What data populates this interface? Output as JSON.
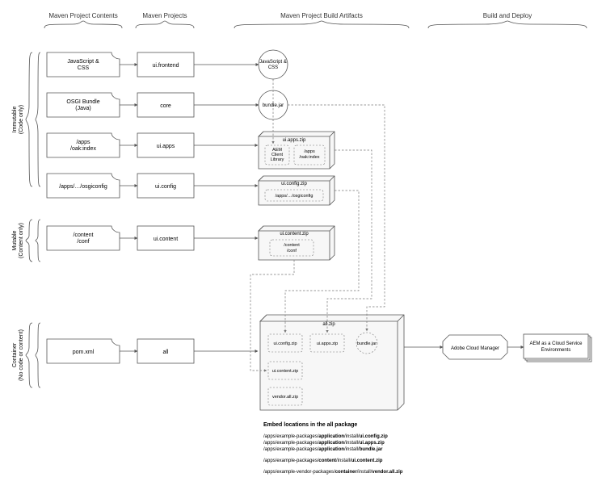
{
  "columns": {
    "contents": "Maven Project Contents",
    "projects": "Maven Projects",
    "artifacts": "Maven Project Build Artifacts",
    "deploy": "Build and Deploy"
  },
  "sideLabels": {
    "immutable1": "Immutable",
    "immutable2": "(Code only)",
    "mutable1": "Mutable",
    "mutable2": "(Content only)",
    "container1": "Container",
    "container2": "(No code or content)"
  },
  "contents": {
    "r0a": "JavaScript &",
    "r0b": "CSS",
    "r1a": "OSGI Bundle",
    "r1b": "(Java)",
    "r2a": "/apps",
    "r2b": "/oak:index",
    "r3": "/apps/…/osgiconfig",
    "r4a": "/content",
    "r4b": "/conf",
    "r5": "pom.xml"
  },
  "projects": {
    "r0": "ui.frontend",
    "r1": "core",
    "r2": "ui.apps",
    "r3": "ui.config",
    "r4": "ui.content",
    "r5": "all"
  },
  "artifacts": {
    "jscss1": "JavaScript &",
    "jscss2": "CSS",
    "bundle": "bundle.jar",
    "uiapps_title": "ui.apps.zip",
    "uiapps_inner1a": "AEM",
    "uiapps_inner1b": "Client",
    "uiapps_inner1c": "Library",
    "uiapps_inner2a": "/apps",
    "uiapps_inner2b": "/oak:index",
    "uiconfig_title": "ui.config.zip",
    "uiconfig_inner": "/apps/…/osgiconfig",
    "uicontent_title": "ui.content.zip",
    "uicontent_inner1": "/content",
    "uicontent_inner2": "/conf",
    "all_title": "all.zip",
    "all_uiconfig": "ui.config.zip",
    "all_uiapps": "ui.apps.zip",
    "all_bundle": "bundle.jar",
    "all_uicontent": "ui.content.zip",
    "all_vendor": "vendor.all.zip"
  },
  "deploy": {
    "acm": "Adobe Cloud Manager",
    "aem1": "AEM as a Cloud Service",
    "aem2": "Environments"
  },
  "footer": {
    "heading": "Embed locations in the all package",
    "l1": "/apps/example-packages/application/install/ui.config.zip",
    "l2": "/apps/example-packages/application/install/ui.apps.zip",
    "l3": "/apps/example-packages/application/install/bundle.jar",
    "l4": "/apps/example-packages/content/install/ui.content.zip",
    "l5": "/apps/example-vendor-packages/container/install/vendor.all.zip"
  }
}
